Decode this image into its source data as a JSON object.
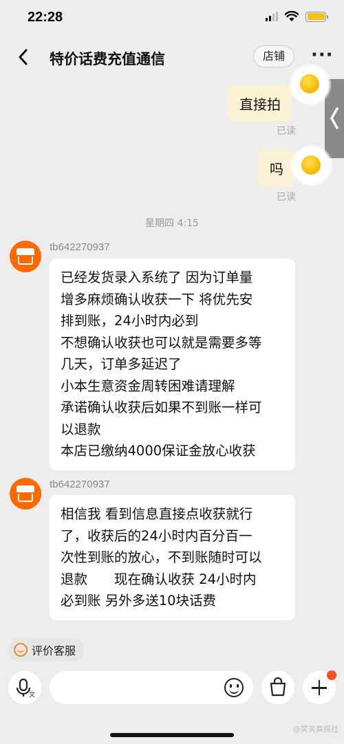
{
  "status": {
    "time": "22:28"
  },
  "header": {
    "title": "特价话费充值通信",
    "shop_label": "店铺"
  },
  "outgoing": [
    {
      "text": "直接拍",
      "status": "已读"
    },
    {
      "text": "吗",
      "status": "已读"
    }
  ],
  "timestamp": "星期四 4:15",
  "incoming": [
    {
      "sender": "tb642270937",
      "lines": [
        "已经发货录入系统了 因为订单量",
        "增多麻烦确认收获一下 将优先安",
        "排到账，24小时内必到",
        "不想确认收获也可以就是需要多等",
        "几天，订单多延迟了",
        "小本生意资金周转困难请理解",
        "承诺确认收获后如果不到账一样可",
        "以退款",
        "本店已缴纳4000保证金放心收获"
      ]
    },
    {
      "sender": "tb642270937",
      "lines": [
        "相信我 看到信息直接点收获就行",
        "了，收获后的24小时内百分百一",
        "次性到账的放心，不到账随时可以",
        "退款　　现在确认收获 24小时内",
        "必到账 另外多送10块话费"
      ]
    }
  ],
  "quick_action": {
    "label": "评价客服"
  },
  "input": {
    "placeholder": ""
  },
  "watermark": "@笑笑真探社",
  "colors": {
    "accent": "#ff6a00",
    "outgoing_bubble": "#fdf1d5",
    "battery": "#f3c216"
  }
}
